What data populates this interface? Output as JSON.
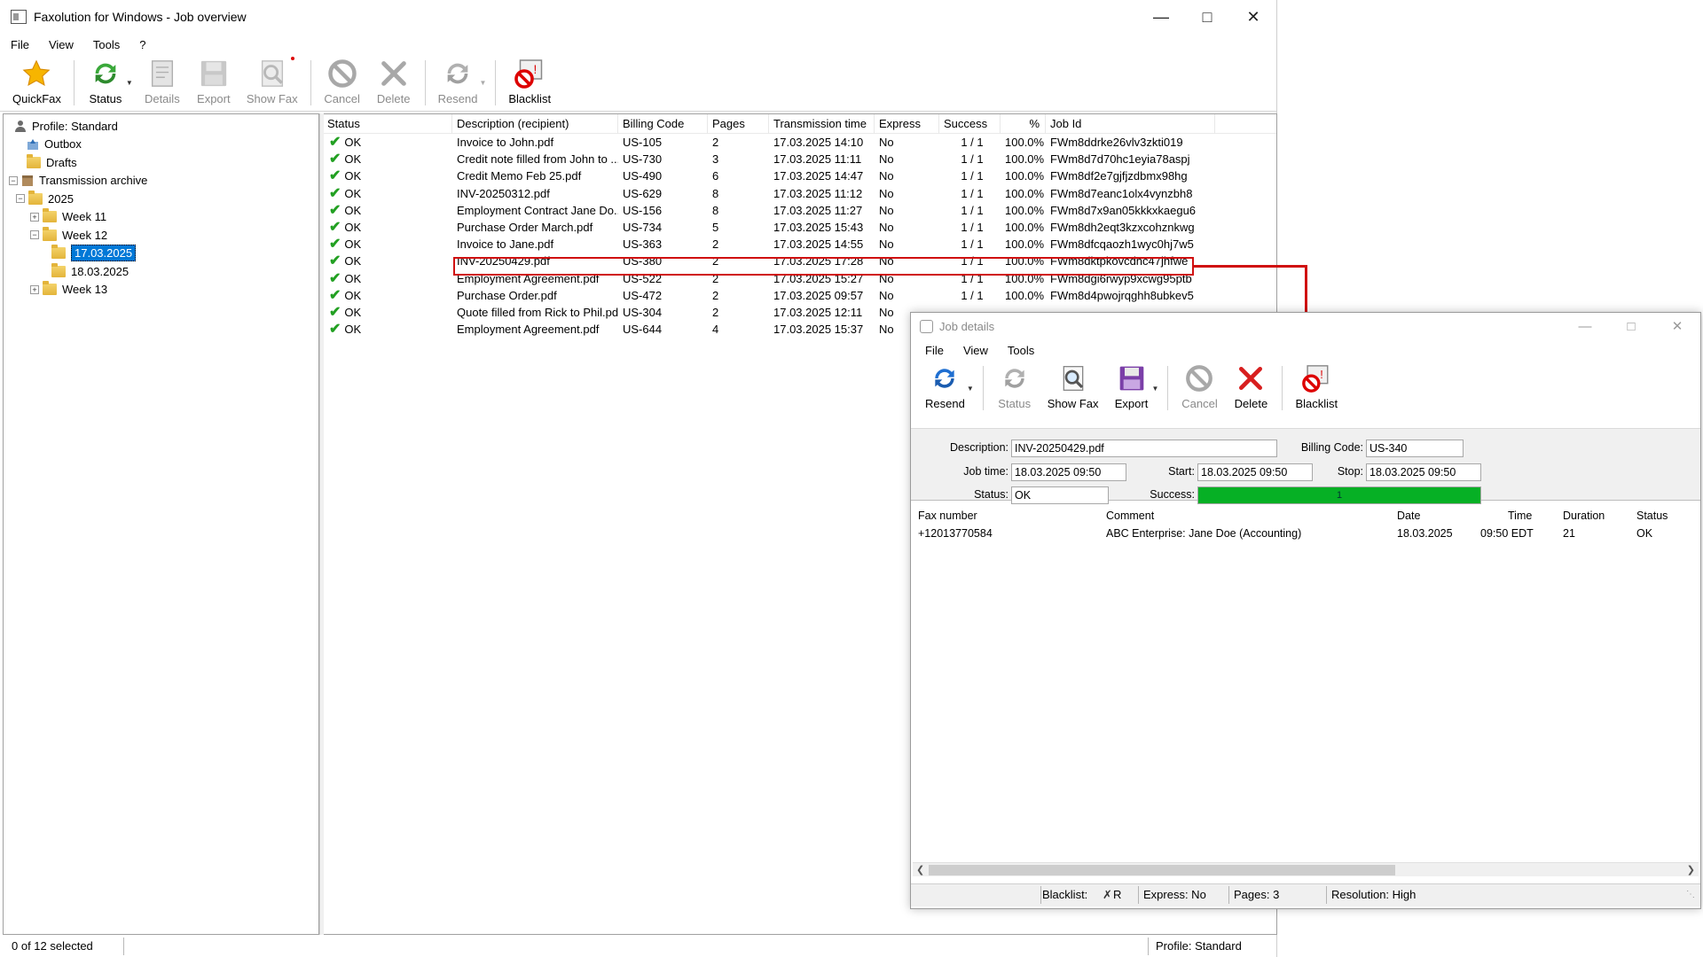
{
  "main": {
    "title": "Faxolution for Windows - Job overview",
    "menu": [
      "File",
      "View",
      "Tools",
      "?"
    ],
    "toolbar": {
      "quickfax": "QuickFax",
      "status": "Status",
      "details": "Details",
      "export": "Export",
      "showfax": "Show Fax",
      "cancel": "Cancel",
      "delete": "Delete",
      "resend": "Resend",
      "blacklist": "Blacklist"
    },
    "tree": {
      "profile": "Profile: Standard",
      "outbox": "Outbox",
      "drafts": "Drafts",
      "archive": "Transmission archive",
      "year": "2025",
      "week11": "Week 11",
      "week12": "Week 12",
      "day1": "17.03.2025",
      "day2": "18.03.2025",
      "week13": "Week 13"
    },
    "columns": [
      "Status",
      "Description (recipient)",
      "Billing Code",
      "Pages",
      "Transmission time",
      "Express",
      "Success",
      "%",
      "Job Id"
    ],
    "jobs": [
      {
        "status": "OK",
        "desc": "Invoice to John.pdf",
        "code": "US-105",
        "pages": "2",
        "time": "17.03.2025 14:10",
        "express": "No",
        "success": "1 / 1",
        "pct": "100.0%",
        "id": "FWm8ddrke26vlv3zkti019"
      },
      {
        "status": "OK",
        "desc": "Credit note filled from John to ...",
        "code": "US-730",
        "pages": "3",
        "time": "17.03.2025 11:11",
        "express": "No",
        "success": "1 / 1",
        "pct": "100.0%",
        "id": "FWm8d7d70hc1eyia78aspj"
      },
      {
        "status": "OK",
        "desc": "Credit Memo Feb 25.pdf",
        "code": "US-490",
        "pages": "6",
        "time": "17.03.2025 14:47",
        "express": "No",
        "success": "1 / 1",
        "pct": "100.0%",
        "id": "FWm8df2e7gjfjzdbmx98hg"
      },
      {
        "status": "OK",
        "desc": "INV-20250312.pdf",
        "code": "US-629",
        "pages": "8",
        "time": "17.03.2025 11:12",
        "express": "No",
        "success": "1 / 1",
        "pct": "100.0%",
        "id": "FWm8d7eanc1olx4vynzbh8"
      },
      {
        "status": "OK",
        "desc": "Employment Contract Jane Do...",
        "code": "US-156",
        "pages": "8",
        "time": "17.03.2025 11:27",
        "express": "No",
        "success": "1 / 1",
        "pct": "100.0%",
        "id": "FWm8d7x9an05kkkxkaegu6"
      },
      {
        "status": "OK",
        "desc": "Purchase Order March.pdf",
        "code": "US-734",
        "pages": "5",
        "time": "17.03.2025 15:43",
        "express": "No",
        "success": "1 / 1",
        "pct": "100.0%",
        "id": "FWm8dh2eqt3kzxcohznkwg"
      },
      {
        "status": "OK",
        "desc": "Invoice to Jane.pdf",
        "code": "US-363",
        "pages": "2",
        "time": "17.03.2025 14:55",
        "express": "No",
        "success": "1 / 1",
        "pct": "100.0%",
        "id": "FWm8dfcqaozh1wyc0hj7w5"
      },
      {
        "status": "OK",
        "desc": "INV-20250429.pdf",
        "code": "US-380",
        "pages": "2",
        "time": "17.03.2025 17:28",
        "express": "No",
        "success": "1 / 1",
        "pct": "100.0%",
        "id": "FWm8dktpkovcdnc47jhfwe"
      },
      {
        "status": "OK",
        "desc": "Employment Agreement.pdf",
        "code": "US-522",
        "pages": "2",
        "time": "17.03.2025 15:27",
        "express": "No",
        "success": "1 / 1",
        "pct": "100.0%",
        "id": "FWm8dgi6rwyp9xcwg95ptb"
      },
      {
        "status": "OK",
        "desc": "Purchase Order.pdf",
        "code": "US-472",
        "pages": "2",
        "time": "17.03.2025 09:57",
        "express": "No",
        "success": "1 / 1",
        "pct": "100.0%",
        "id": "FWm8d4pwojrqghh8ubkev5"
      },
      {
        "status": "OK",
        "desc": "Quote filled from Rick to Phil.pdf",
        "code": "US-304",
        "pages": "2",
        "time": "17.03.2025 12:11",
        "express": "No",
        "success": "",
        "pct": "",
        "id": ""
      },
      {
        "status": "OK",
        "desc": "Employment Agreement.pdf",
        "code": "US-644",
        "pages": "4",
        "time": "17.03.2025 15:37",
        "express": "No",
        "success": "",
        "pct": "",
        "id": ""
      }
    ],
    "statusbar": {
      "left": "0 of 12 selected",
      "right": "Profile: Standard"
    }
  },
  "details": {
    "title": "Job details",
    "menu": [
      "File",
      "View",
      "Tools"
    ],
    "toolbar": {
      "resend": "Resend",
      "status": "Status",
      "showfax": "Show Fax",
      "export": "Export",
      "cancel": "Cancel",
      "delete": "Delete",
      "blacklist": "Blacklist"
    },
    "form": {
      "desc_label": "Description:",
      "desc": "INV-20250429.pdf",
      "code_label": "Billing Code:",
      "code": "US-340",
      "jobtime_label": "Job time:",
      "jobtime": "18.03.2025 09:50",
      "start_label": "Start:",
      "start": "18.03.2025 09:50",
      "stop_label": "Stop:",
      "stop": "18.03.2025 09:50",
      "status_label": "Status:",
      "status": "OK",
      "success_label": "Success:",
      "success_text": "1",
      "success_fraction": 1.0
    },
    "table": {
      "columns": [
        "Fax number",
        "Comment",
        "Date",
        "Time",
        "Duration",
        "Status"
      ],
      "row": {
        "fax": "+12013770584",
        "comment": "ABC Enterprise: Jane Doe (Accounting)",
        "date": "18.03.2025",
        "time": "09:50 EDT",
        "duration": "21",
        "status": "OK"
      }
    },
    "statusbar": {
      "blacklist": "Blacklist:",
      "blacklist_val": "R",
      "express": "Express: No",
      "pages": "Pages: 3",
      "resolution": "Resolution: High"
    }
  },
  "colors": {
    "accent": "#0078d7",
    "highlight": "#d01010",
    "success": "#06b025",
    "ok_check": "#22a022"
  }
}
